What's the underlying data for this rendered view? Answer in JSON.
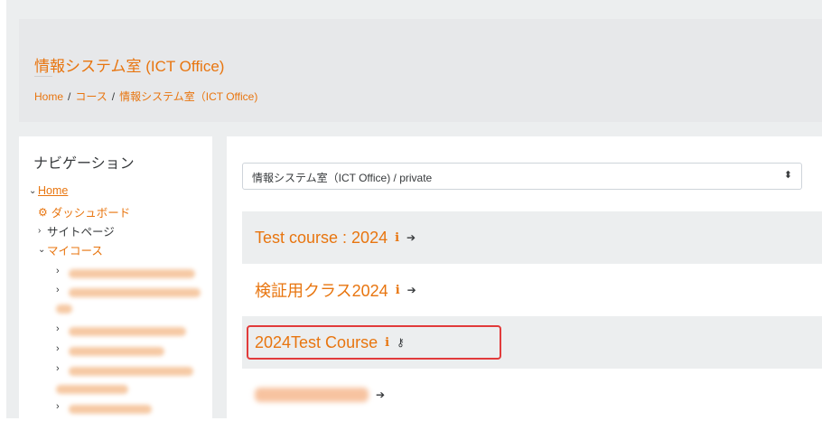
{
  "header": {
    "site_title": "情報システム室 (ICT Office)",
    "breadcrumb": [
      "Home",
      "コース",
      "情報システム室（ICT Office)"
    ],
    "separator": "/"
  },
  "navigation": {
    "title": "ナビゲーション",
    "home": "Home",
    "dashboard": "ダッシュボード",
    "site_pages": "サイトページ",
    "my_courses": "マイコース"
  },
  "main": {
    "category_select": "情報システム室（ICT Office) / private",
    "courses": [
      {
        "name": "Test course : 2024",
        "access": "enrol"
      },
      {
        "name": "検証用クラス2024",
        "access": "enrol"
      },
      {
        "name": "2024Test Course",
        "access": "key"
      },
      {
        "name": "",
        "access": "enrol"
      }
    ]
  },
  "icons": {
    "info": "info-icon",
    "enrol": "enrol-icon",
    "key": "key-icon"
  },
  "colors": {
    "accent": "#e8750f",
    "highlight": "#e13b3b"
  }
}
